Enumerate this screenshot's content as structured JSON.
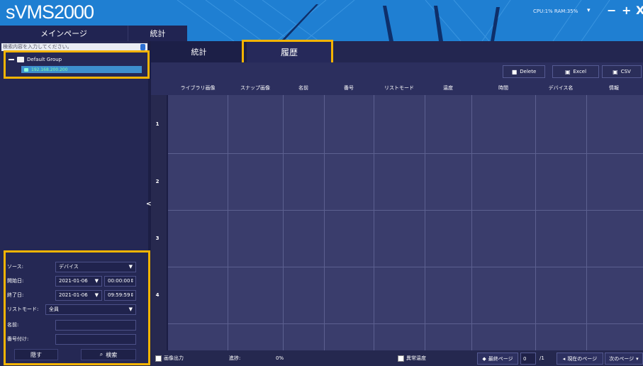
{
  "header": {
    "app_title": "sVMS2000",
    "nav_tabs": [
      "メインページ",
      "統計"
    ],
    "sysinfo": "CPU:1% RAM:35%",
    "controls": {
      "dropdown": "▾",
      "minimize": "−",
      "add": "+",
      "close": "X"
    }
  },
  "left": {
    "search_placeholder": "検索内容を入力してください。",
    "tree": {
      "group": "Default Group",
      "device": "192.168.200.200"
    },
    "form": {
      "source_label": "ソース:",
      "source_value": "デバイス",
      "start_label": "開始日:",
      "start_date": "2021-01-06",
      "start_time": "00:00:00",
      "end_label": "終了日:",
      "end_date": "2021-01-06",
      "end_time": "09:59:59",
      "listmode_label": "リストモード:",
      "listmode_value": "全員",
      "name_label": "名前:",
      "name_value": "",
      "number_label": "番号付け:",
      "number_value": "",
      "hide_button": "隠す",
      "search_button": "検索"
    },
    "collapse": "<"
  },
  "main": {
    "tabs": [
      "統計",
      "履歴"
    ],
    "toolbar": {
      "delete": "Delete",
      "excel": "Excel",
      "csv": "CSV"
    },
    "columns": [
      "ライブラリ画像",
      "スナップ画像",
      "名前",
      "番号",
      "リストモード",
      "温度",
      "時間",
      "デバイス名",
      "情報"
    ],
    "rows": [
      "1",
      "2",
      "3",
      "4"
    ]
  },
  "status": {
    "image_output": "画像出力",
    "progress_label": "進捗:",
    "progress_value": "0%",
    "progress_fraction": 0,
    "abnormal_temp": "異常温度",
    "last_page": "最終ページ",
    "page_current": "0",
    "page_total": "/1",
    "current_page": "現在のページ",
    "next_page": "次のページ"
  },
  "colors": {
    "accent": "#1f7fd2",
    "highlight": "#f4b400",
    "background": "#2b2d5a"
  }
}
